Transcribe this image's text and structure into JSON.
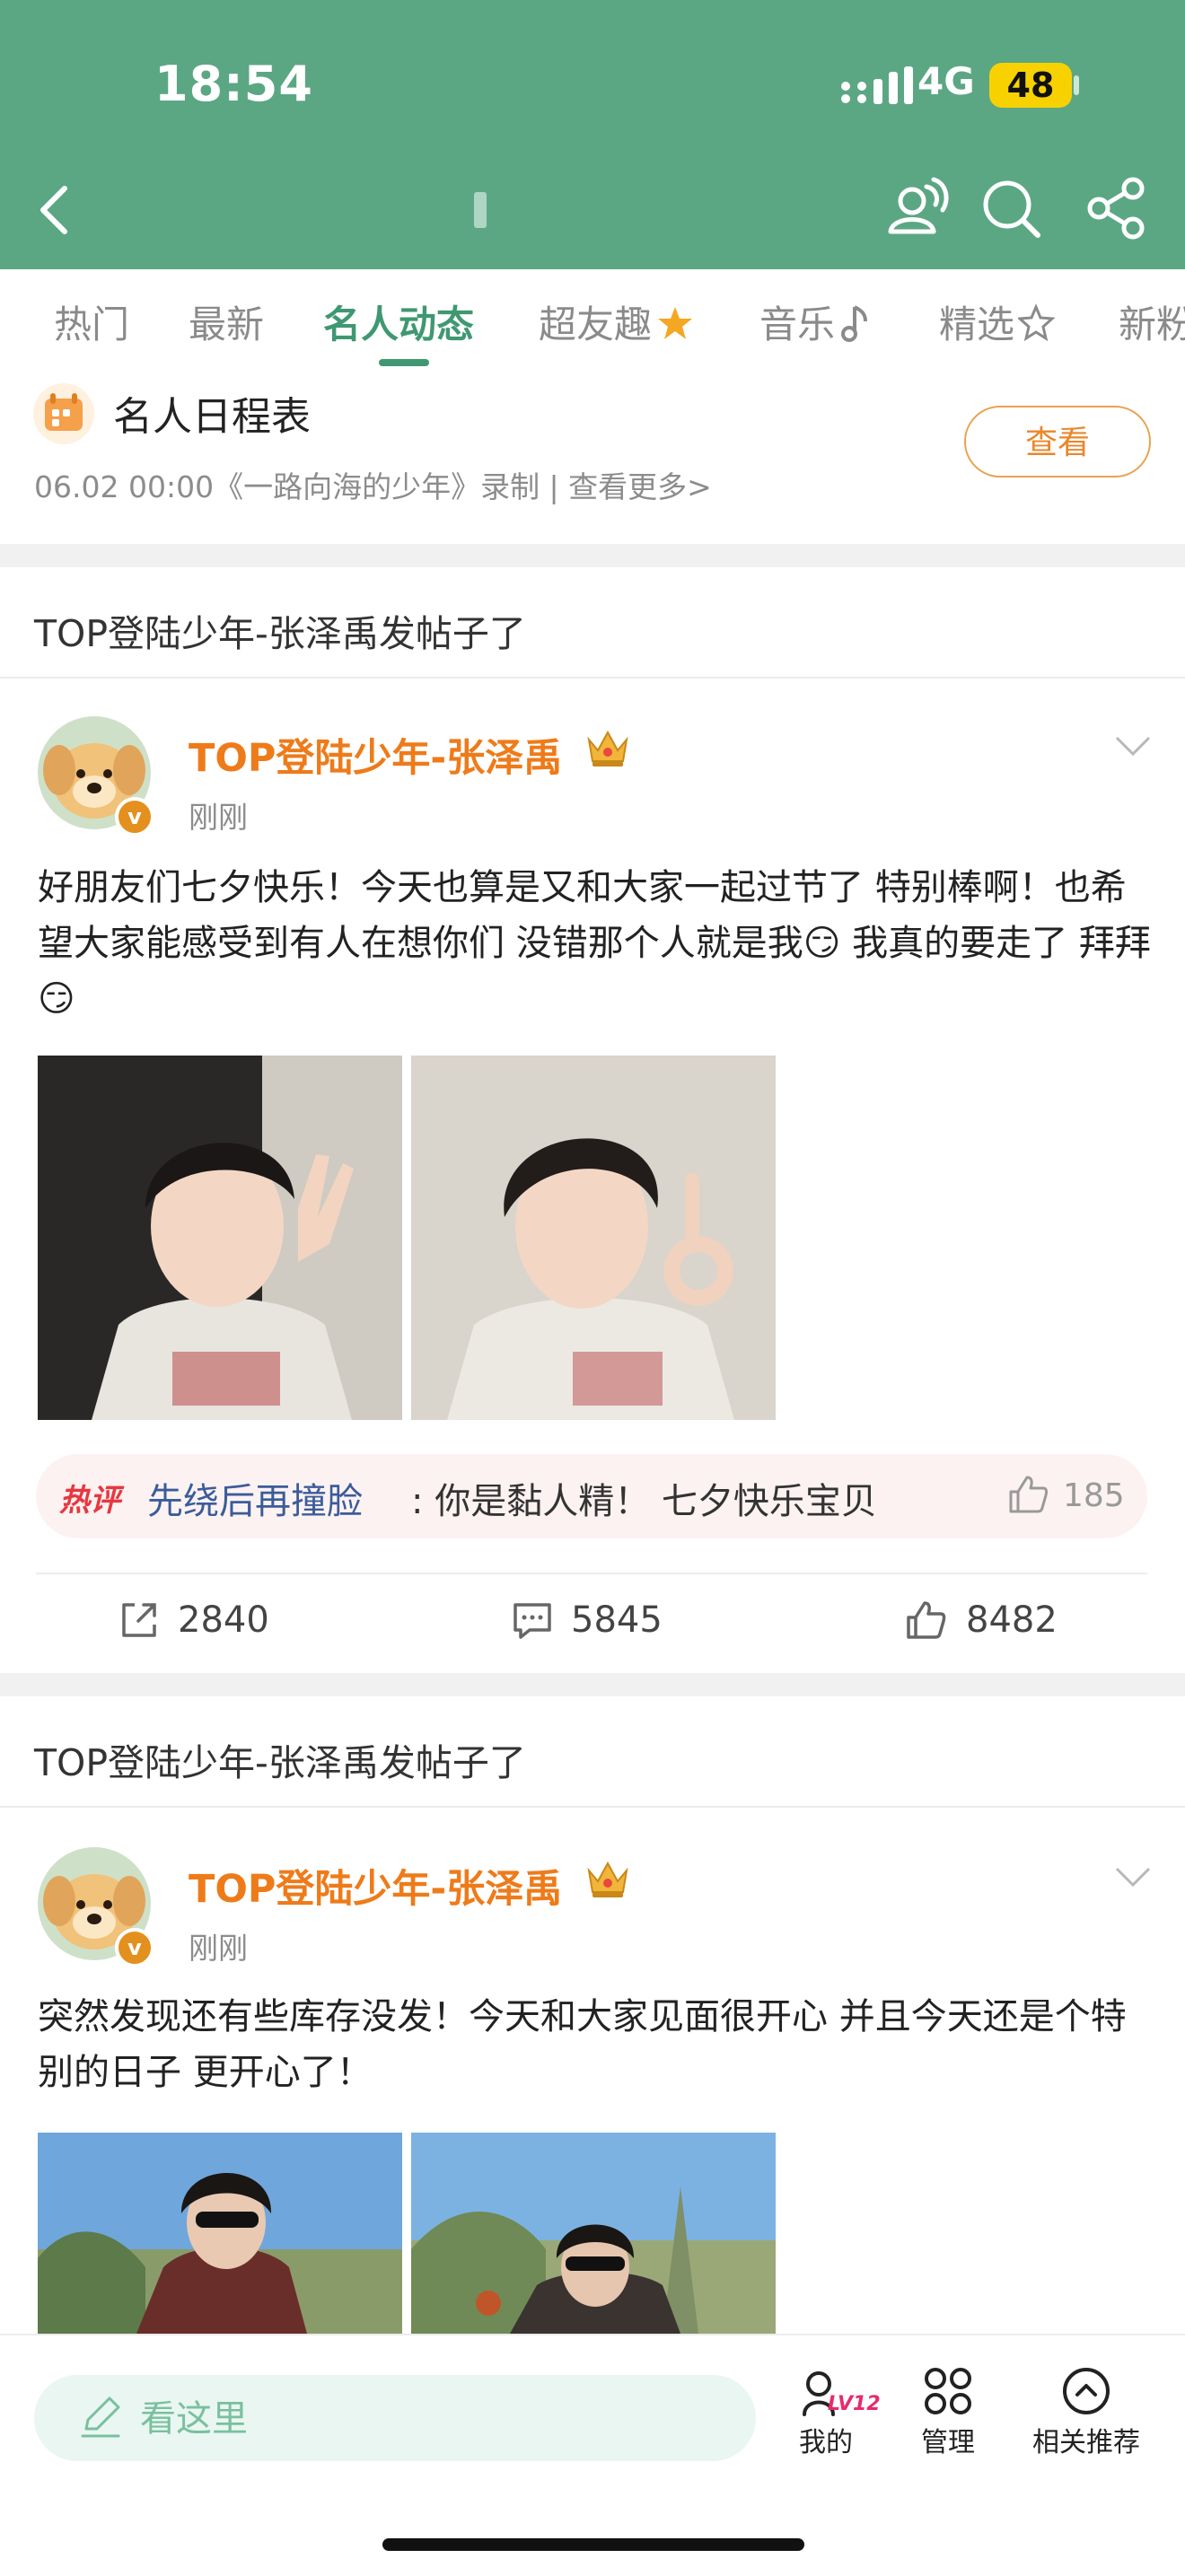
{
  "status_bar": {
    "time": "18:54",
    "network": "4G",
    "battery": "48"
  },
  "tabs": [
    {
      "label": "热门"
    },
    {
      "label": "最新"
    },
    {
      "label": "名人动态"
    },
    {
      "label": "超友趣"
    },
    {
      "label": "音乐"
    },
    {
      "label": "精选"
    },
    {
      "label": "新粉"
    }
  ],
  "schedule": {
    "title": "名人日程表",
    "subtitle": "06.02 00:00《一路向海的少年》录制 |  查看更多>",
    "view_button": "查看"
  },
  "posts": [
    {
      "section_title": "TOP登陆少年-张泽禹发帖子了",
      "username": "TOP登陆少年-张泽禹",
      "time": "刚刚",
      "text": "好朋友们七夕快乐！今天也算是又和大家一起过节了 特别棒啊！也希望大家能感受到有人在想你们 没错那个人就是我😏 我真的要走了 拜拜😏",
      "hot_comment": {
        "tag": "热评",
        "user": "先绕后再撞脸",
        "text": ": 你是黏人精！ 七夕快乐宝贝",
        "likes": "185"
      },
      "reposts": "2840",
      "comments": "5845",
      "likes": "8482"
    },
    {
      "section_title": "TOP登陆少年-张泽禹发帖子了",
      "username": "TOP登陆少年-张泽禹",
      "time": "刚刚",
      "text": "突然发现还有些库存没发！今天和大家见面很开心 并且今天还是个特别的日子 更开心了！"
    }
  ],
  "bottom_bar": {
    "comment_placeholder": "看这里",
    "level": "LV12",
    "mine": "我的",
    "manage": "管理",
    "recommend": "相关推荐"
  },
  "colors": {
    "header": "#5ba784",
    "accent": "#3f9872",
    "username": "#ee7b1a"
  }
}
